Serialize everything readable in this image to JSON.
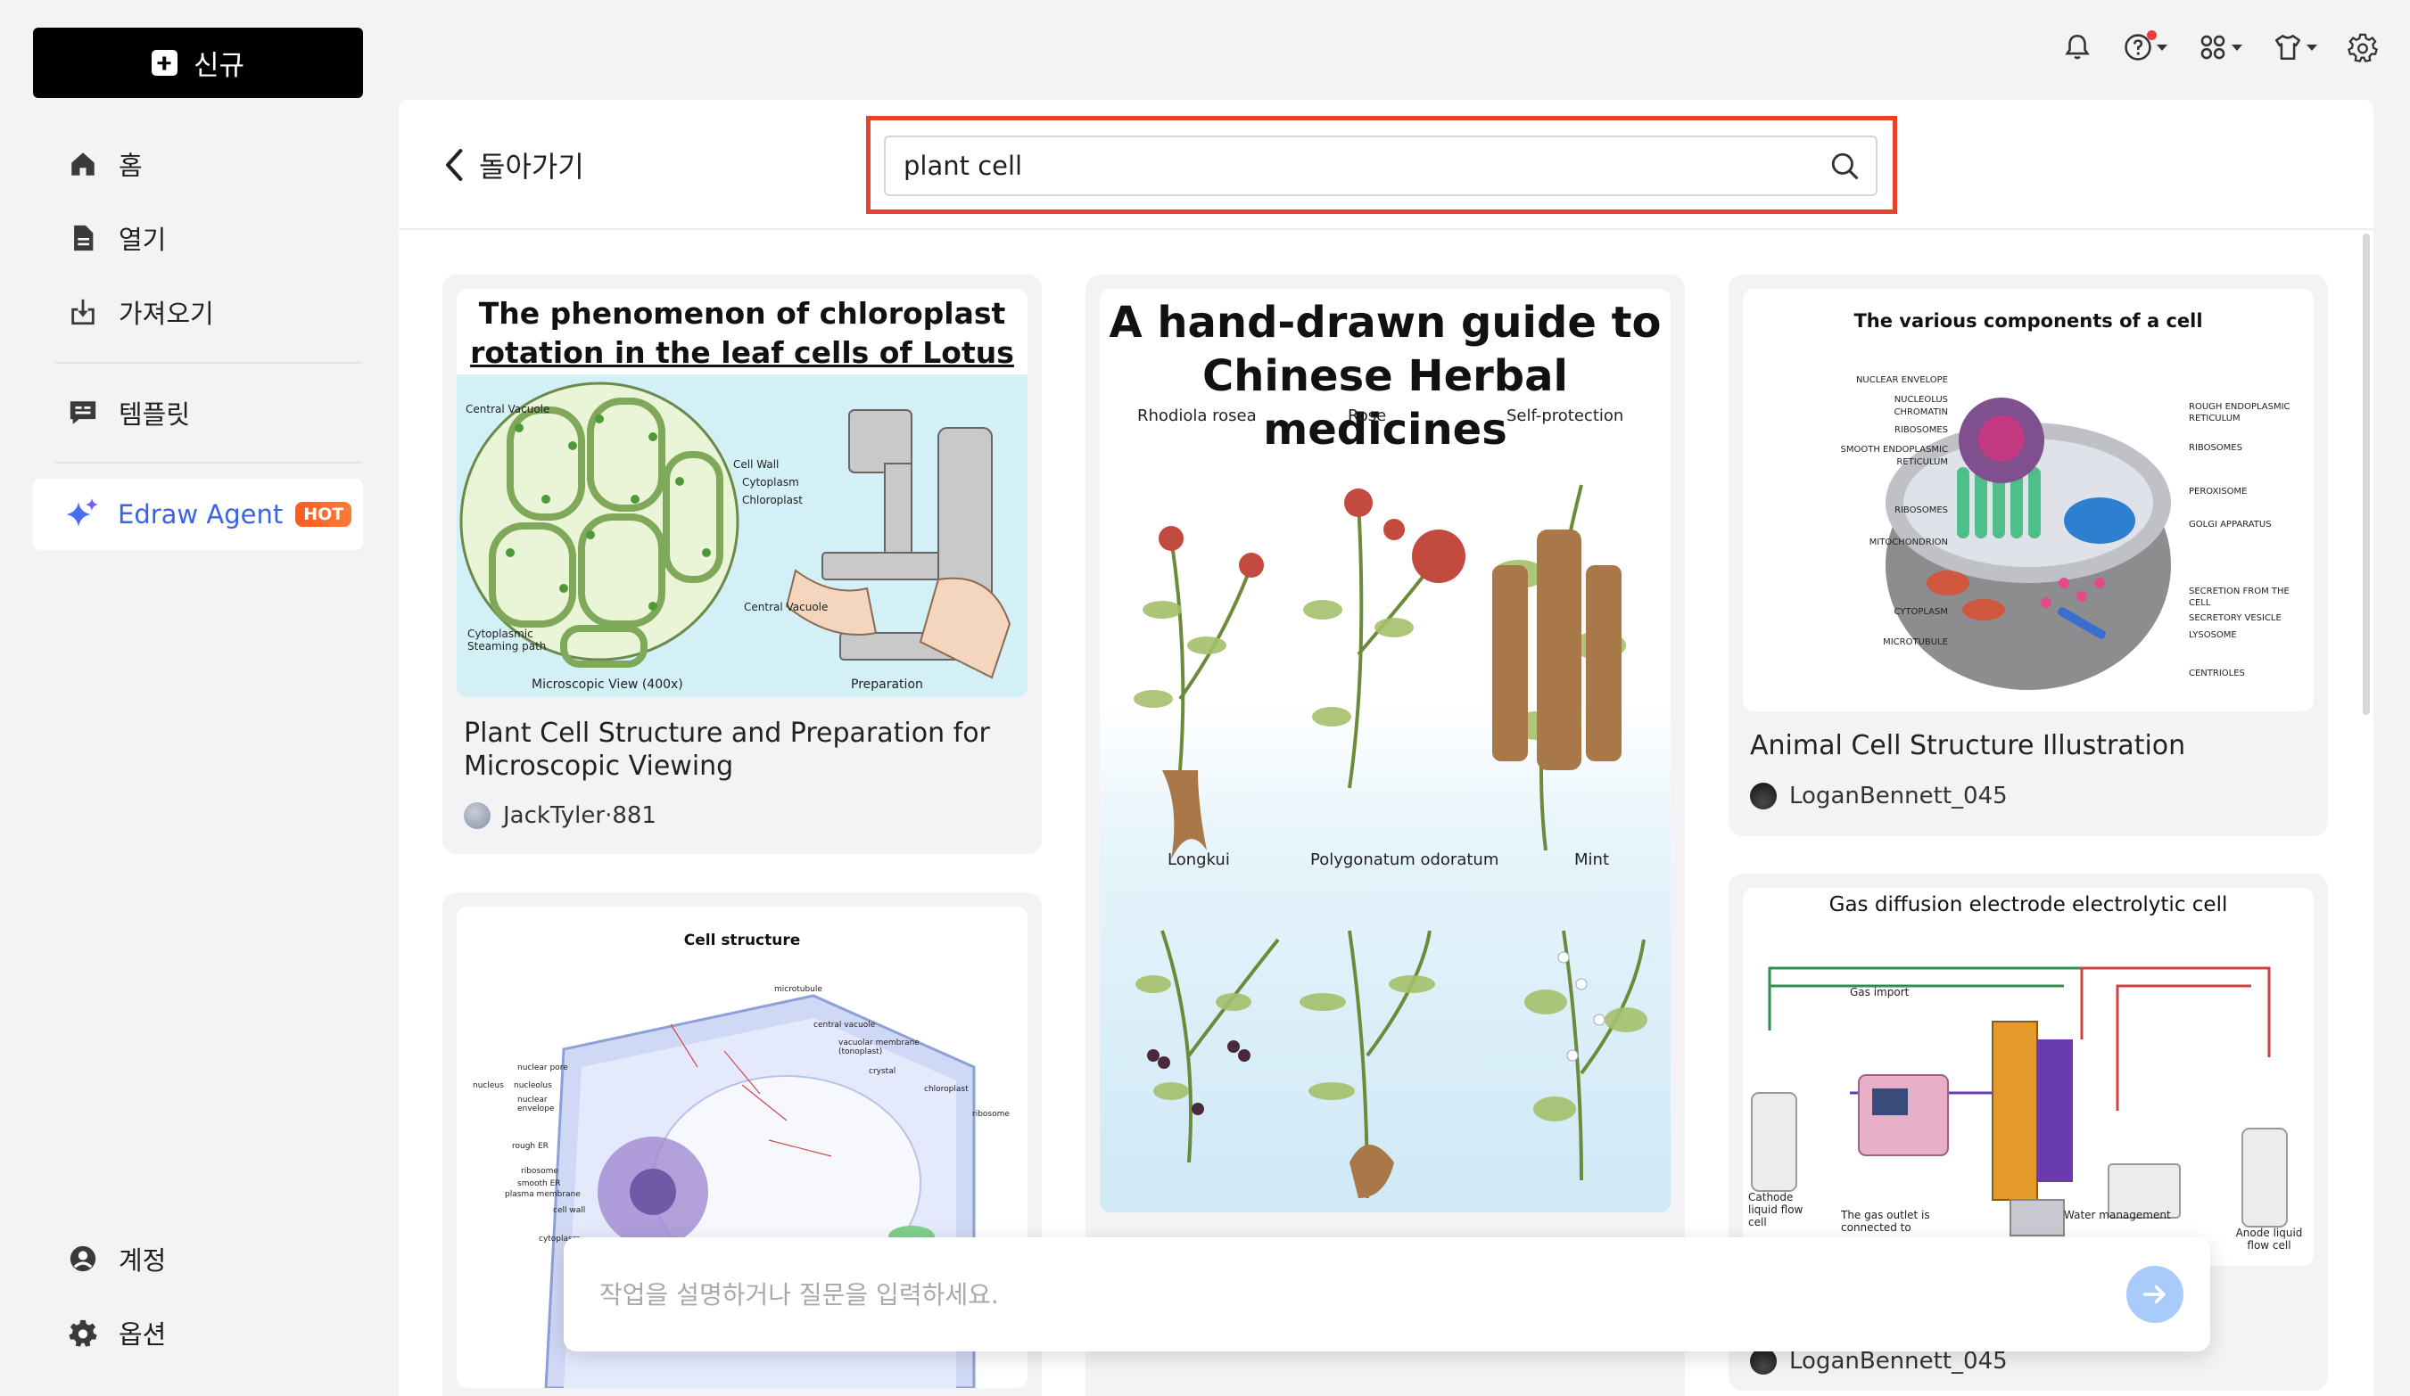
{
  "sidebar": {
    "new_label": "신규",
    "items": [
      {
        "label": "홈",
        "icon": "home-icon"
      },
      {
        "label": "열기",
        "icon": "document-icon"
      },
      {
        "label": "가져오기",
        "icon": "import-icon"
      },
      {
        "label": "템플릿",
        "icon": "template-icon"
      }
    ],
    "agent": {
      "label": "Edraw Agent",
      "badge": "HOT",
      "icon": "sparkle-icon"
    },
    "bottom": [
      {
        "label": "계정",
        "icon": "account-icon"
      },
      {
        "label": "옵션",
        "icon": "gear-icon"
      }
    ]
  },
  "topbar": {
    "icons": [
      "bell-icon",
      "help-icon",
      "apps-icon",
      "shirt-icon",
      "settings-icon"
    ]
  },
  "header": {
    "back_label": "돌아가기",
    "search_value": "plant cell"
  },
  "cards": [
    {
      "title": "Plant Cell Structure and Preparation for Microscopic Viewing",
      "author": "JackTyler·881",
      "thumb": {
        "heading_line1": "The phenomenon of chloroplast",
        "heading_line2": "rotation in the leaf cells of Lotus seeds",
        "labels": [
          "Central Vacuole",
          "Cell Wall",
          "Cytoplasm",
          "Chloroplast",
          "Central Vacuole",
          "Cytoplasmic Steaming path",
          "Microscopic View (400x)",
          "Preparation"
        ]
      }
    },
    {
      "title": "",
      "author": "",
      "thumb": {
        "heading_line1": "A hand-drawn guide to",
        "heading_line2": "Chinese Herbal medicines",
        "labels": [
          "Rhodiola rosea",
          "Rose",
          "Self-protection",
          "Longkui",
          "Polygonatum odoratum",
          "Mint"
        ]
      }
    },
    {
      "title": "Animal Cell Structure Illustration",
      "author": "LoganBennett_045",
      "thumb": {
        "heading_line1": "The various components of a cell",
        "labels_left": [
          "NUCLEAR ENVELOPE",
          "NUCLEOLUS",
          "CHROMATIN",
          "RIBOSOMES",
          "SMOOTH ENDOPLASMIC RETICULUM",
          "RIBOSOMES",
          "MITOCHONDRION",
          "CYTOPLASM",
          "MICROTUBULE"
        ],
        "labels_right": [
          "ROUGH ENDOPLASMIC RETICULUM",
          "RIBOSOMES",
          "PEROXISOME",
          "GOLGI APPARATUS",
          "SECRETION FROM THE CELL",
          "SECRETORY VESICLE",
          "LYSOSOME",
          "CENTRIOLES"
        ]
      }
    },
    {
      "title": "",
      "author": "",
      "thumb": {
        "heading_line1": "Cell structure",
        "labels": [
          "microtubule",
          "central vacuole",
          "vacuolar membrane (tonoplast)",
          "crystal",
          "chloroplast",
          "ribosome",
          "nuclear pore",
          "nucleus",
          "nucleolus",
          "nuclear envelope",
          "rough ER",
          "ribosome",
          "smooth ER",
          "plasma membrane",
          "cell wall",
          "cytoplasm"
        ]
      }
    },
    {
      "title": "",
      "author": "LoganBennett_045",
      "thumb": {
        "heading_line1": "Gas diffusion electrode electrolytic cell",
        "labels": [
          "Gas import",
          "Cathode liquid flow cell",
          "The gas outlet is connected to",
          "Water management",
          "Anode liquid flow cell"
        ]
      }
    }
  ],
  "prompt": {
    "placeholder": "작업을 설명하거나 질문을 입력하세요."
  },
  "colors": {
    "accent": "#3b63e8",
    "hot_badge": "#ff6a2a",
    "search_highlight": "#e8412c",
    "send_button": "#a9cbfb"
  }
}
